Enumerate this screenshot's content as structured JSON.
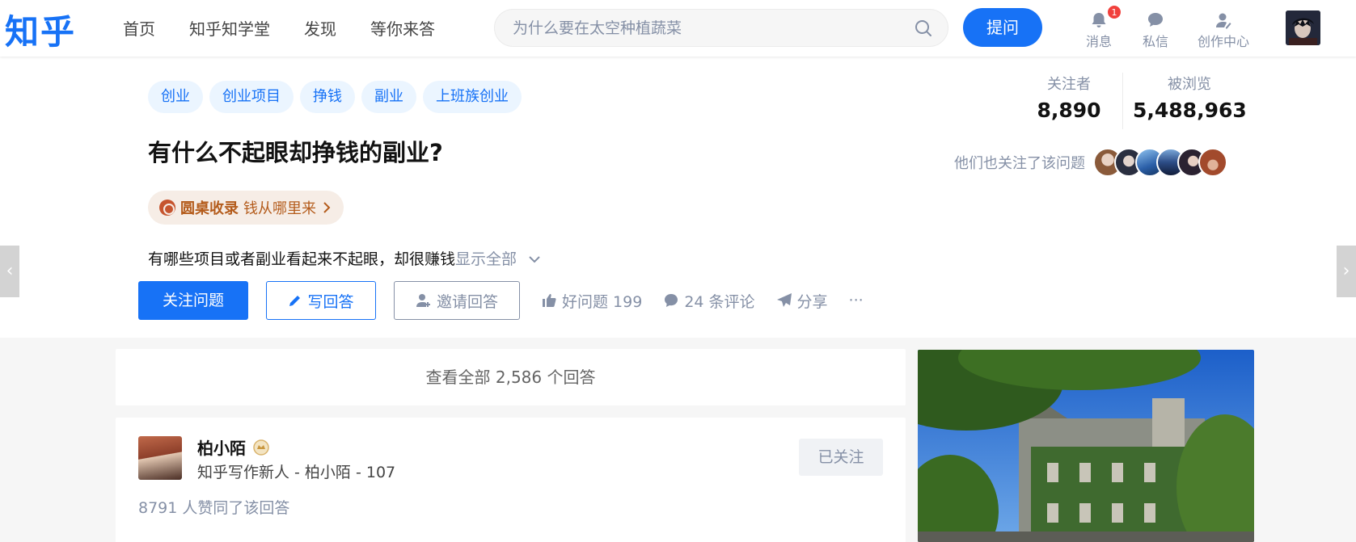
{
  "topbar": {
    "logo": "知乎",
    "nav": [
      "首页",
      "知乎知学堂",
      "发现",
      "等你来答"
    ],
    "search_placeholder": "为什么要在太空种植蔬菜",
    "ask_label": "提问",
    "notifications_label": "消息",
    "notifications_count": "1",
    "messages_label": "私信",
    "creator_label": "创作中心"
  },
  "question": {
    "tags": [
      "创业",
      "创业项目",
      "挣钱",
      "副业",
      "上班族创业"
    ],
    "title": "有什么不起眼却挣钱的副业?",
    "roundtable_label": "圆桌收录",
    "roundtable_name": "钱从哪里来",
    "description": "有哪些项目或者副业看起来不起眼，却很赚钱",
    "show_all": "显示全部",
    "follow_btn": "关注问题",
    "write_btn": "写回答",
    "invite_btn": "邀请回答",
    "good_question": "好问题 199",
    "comments": "24 条评论",
    "share": "分享",
    "more": "···"
  },
  "stats": {
    "followers_label": "关注者",
    "followers": "8,890",
    "views_label": "被浏览",
    "views": "5,488,963",
    "also_followed": "他们也关注了该问题"
  },
  "colors": {
    "accent": "#1772f6",
    "muted": "#8590a6",
    "roundtable": "#b45c1c"
  },
  "feed": {
    "view_all": "查看全部 2,586 个回答",
    "answer": {
      "author": "柏小陌",
      "bio": "知乎写作新人 - 柏小陌 - 107",
      "followed_label": "已关注",
      "votes": "8791 人赞同了该回答"
    }
  }
}
